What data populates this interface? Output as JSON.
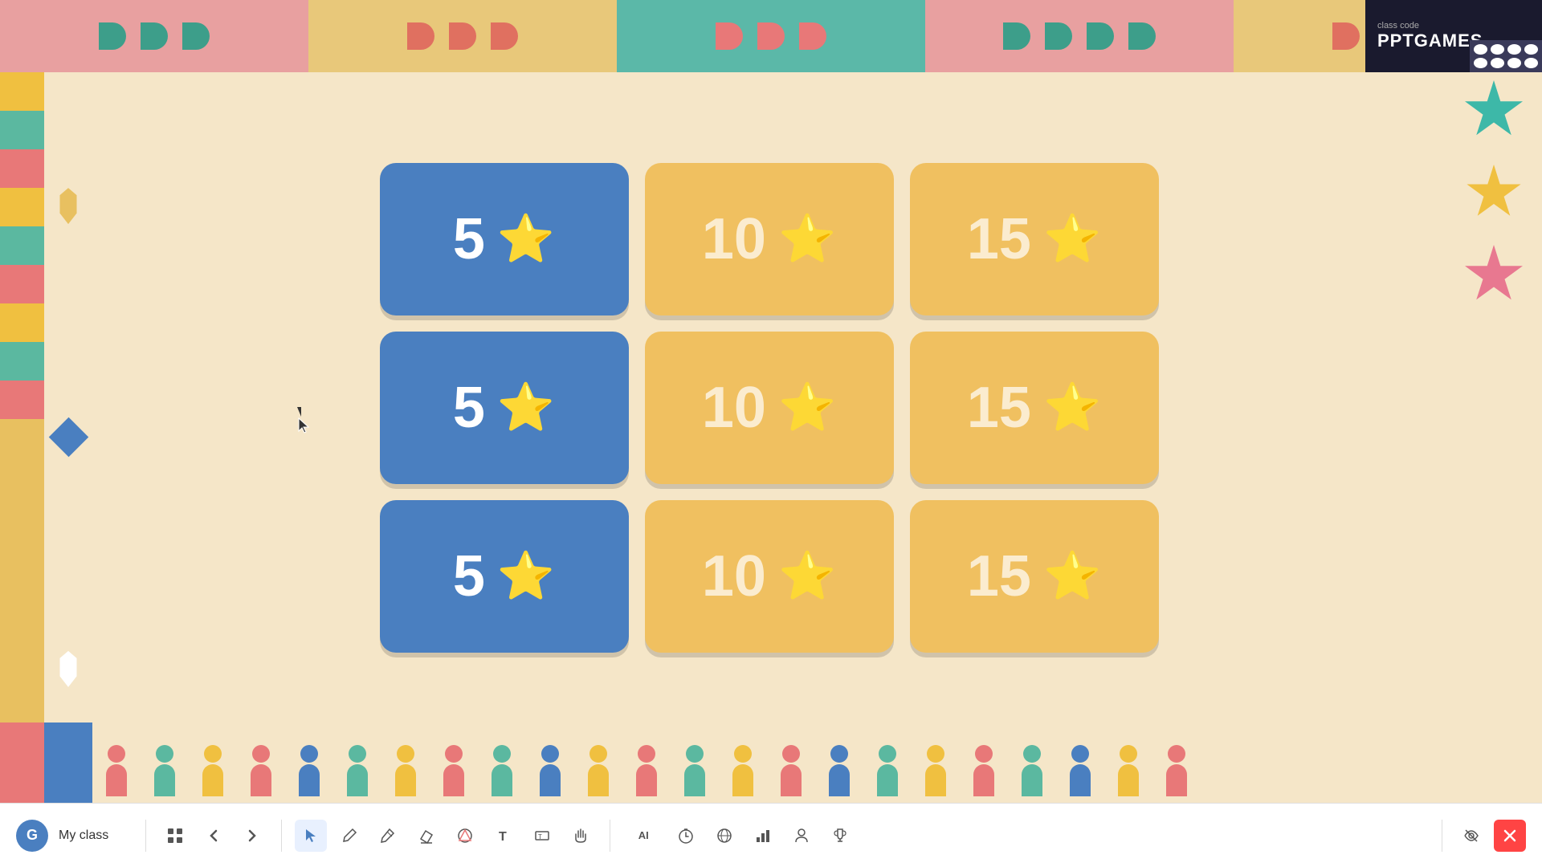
{
  "app": {
    "title": "PPTGAMES",
    "class_code_label": "class code",
    "my_class_label": "My class"
  },
  "cards": [
    {
      "value": "5",
      "type": "blue",
      "row": 0,
      "col": 0
    },
    {
      "value": "10",
      "type": "yellow",
      "row": 0,
      "col": 1
    },
    {
      "value": "15",
      "type": "yellow",
      "row": 0,
      "col": 2
    },
    {
      "value": "5",
      "type": "blue",
      "row": 1,
      "col": 0
    },
    {
      "value": "10",
      "type": "yellow",
      "row": 1,
      "col": 1
    },
    {
      "value": "15",
      "type": "yellow",
      "row": 1,
      "col": 2
    },
    {
      "value": "5",
      "type": "blue",
      "row": 2,
      "col": 0
    },
    {
      "value": "10",
      "type": "yellow",
      "row": 2,
      "col": 1
    },
    {
      "value": "15",
      "type": "yellow",
      "row": 2,
      "col": 2
    }
  ],
  "toolbar": {
    "grid_icon": "⊞",
    "back_icon": "←",
    "forward_icon": "→",
    "cursor_icon": "↖",
    "pen_icon": "✏",
    "marker_icon": "✒",
    "highlight_icon": "▲",
    "eraser_icon": "⌫",
    "shapes_icon": "◯",
    "textbox_icon": "▤",
    "hand_icon": "✋",
    "ai_label": "AI",
    "timer_icon": "⏱",
    "globe_icon": "🌐",
    "chart_icon": "📊",
    "person_icon": "👤",
    "trophy_icon": "🏆",
    "eye_slash_icon": "👁",
    "close_icon": "✕"
  },
  "colors": {
    "blue_card": "#4a7fc0",
    "yellow_card": "#f0c060",
    "bg": "#f5e6c8",
    "top_pink": "#e8a0a0",
    "top_teal": "#5bb8a8",
    "top_orange": "#e8c060",
    "toolbar_bg": "#ffffff",
    "logo_bg": "#1a1a2e"
  }
}
